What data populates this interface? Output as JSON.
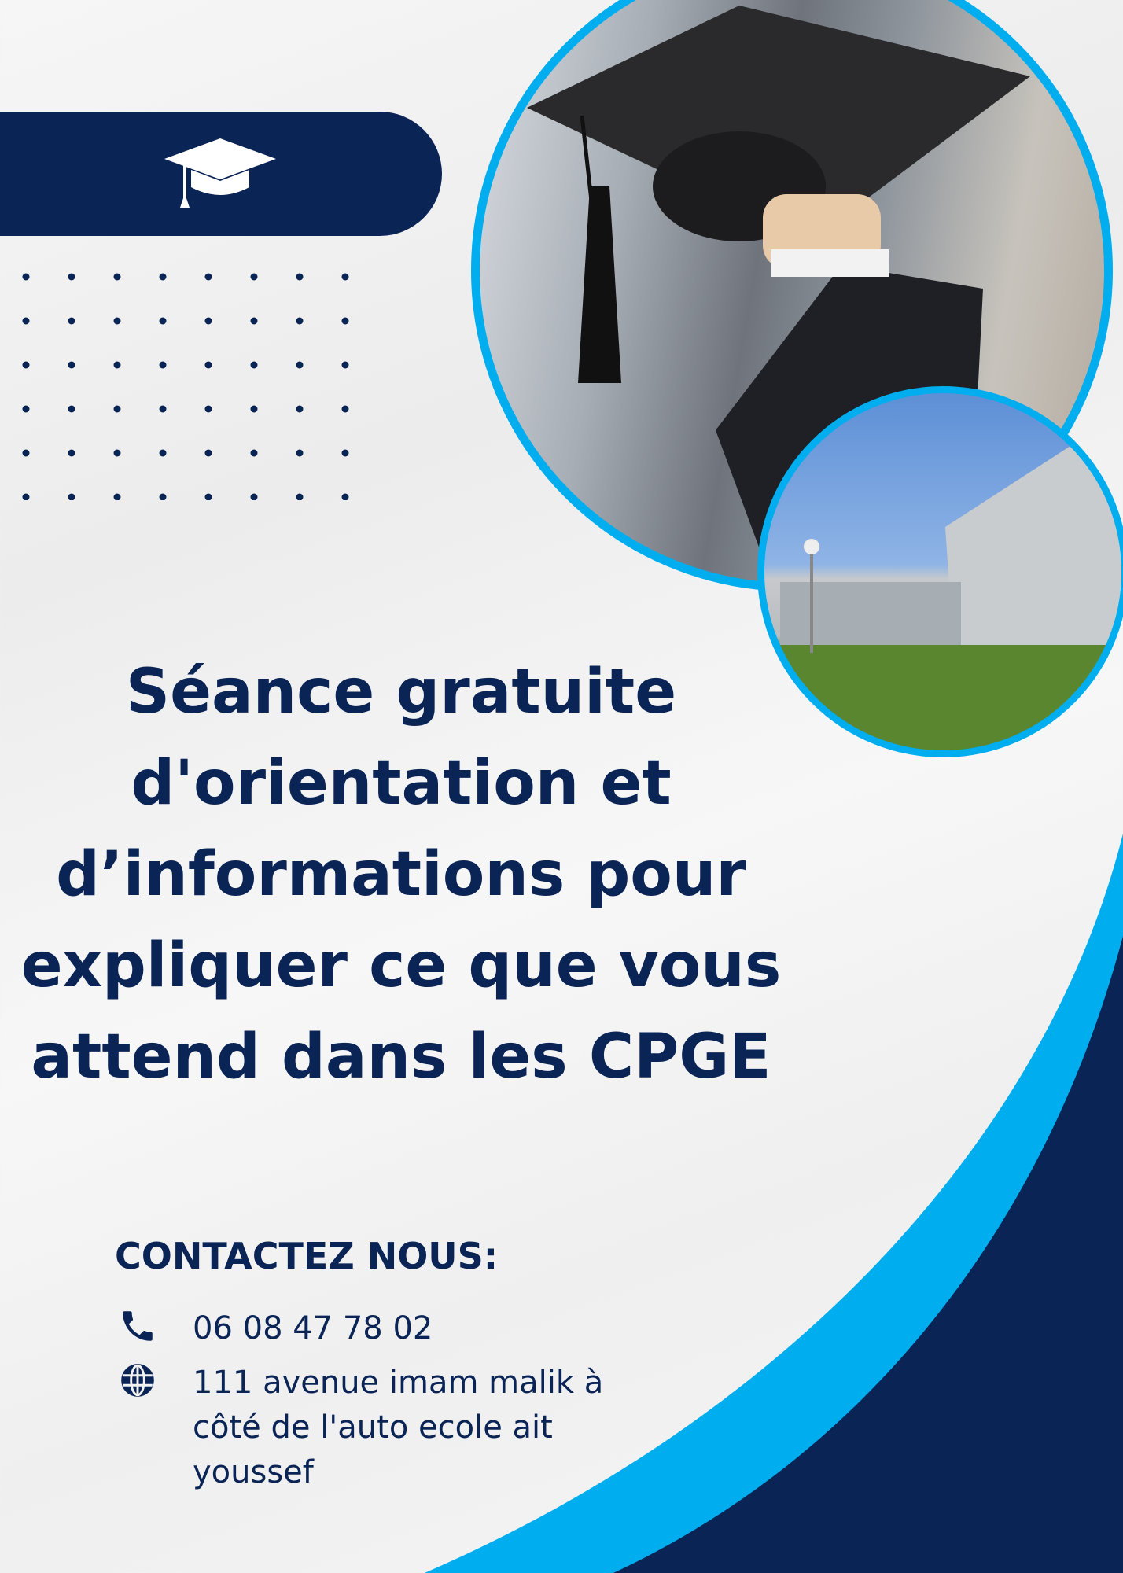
{
  "banner": {
    "icon": "graduation-cap-icon"
  },
  "photos": {
    "main": "graduate-holding-cap-photo",
    "secondary": "campus-building-photo"
  },
  "title": {
    "lines": [
      "Séance gratuite",
      "d'orientation et",
      "d’informations pour",
      "expliquer ce que vous",
      "attend dans les CPGE"
    ]
  },
  "contact": {
    "heading": "CONTACTEZ NOUS:",
    "phone": {
      "icon": "phone-icon",
      "text": "06 08 47 78 02"
    },
    "address": {
      "icon": "globe-icon",
      "lines": [
        "111 avenue imam malik à",
        "côté de l'auto ecole ait",
        "youssef"
      ]
    }
  },
  "colors": {
    "navy": "#0b2456",
    "accent": "#00aeef",
    "background": "#f2f2f2"
  }
}
